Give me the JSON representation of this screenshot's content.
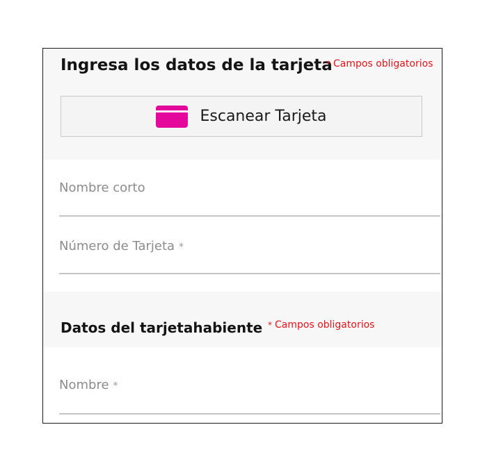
{
  "card_section": {
    "title": "Ingresa los datos de la tarjeta",
    "required_note": "Campos obligatorios",
    "required_star": "*",
    "scan_button_label": "Escanear Tarjeta",
    "scan_icon": "credit-card-icon",
    "fields": [
      {
        "placeholder": "Nombre corto",
        "required": false
      },
      {
        "placeholder": "Número de Tarjeta",
        "required": true,
        "required_mark": "*"
      }
    ]
  },
  "holder_section": {
    "title": "Datos del tarjetahabiente",
    "required_note": "Campos obligatorios",
    "required_star": "*",
    "fields": [
      {
        "placeholder": "Nombre",
        "required": true,
        "required_mark": "*"
      }
    ]
  },
  "colors": {
    "accent": "#e3079b",
    "required_text": "#e3141b",
    "placeholder_text": "#8c8c8c",
    "underline": "#c4c4c4",
    "section_bg": "#f7f7f7",
    "input_bg": "#ffffff"
  }
}
